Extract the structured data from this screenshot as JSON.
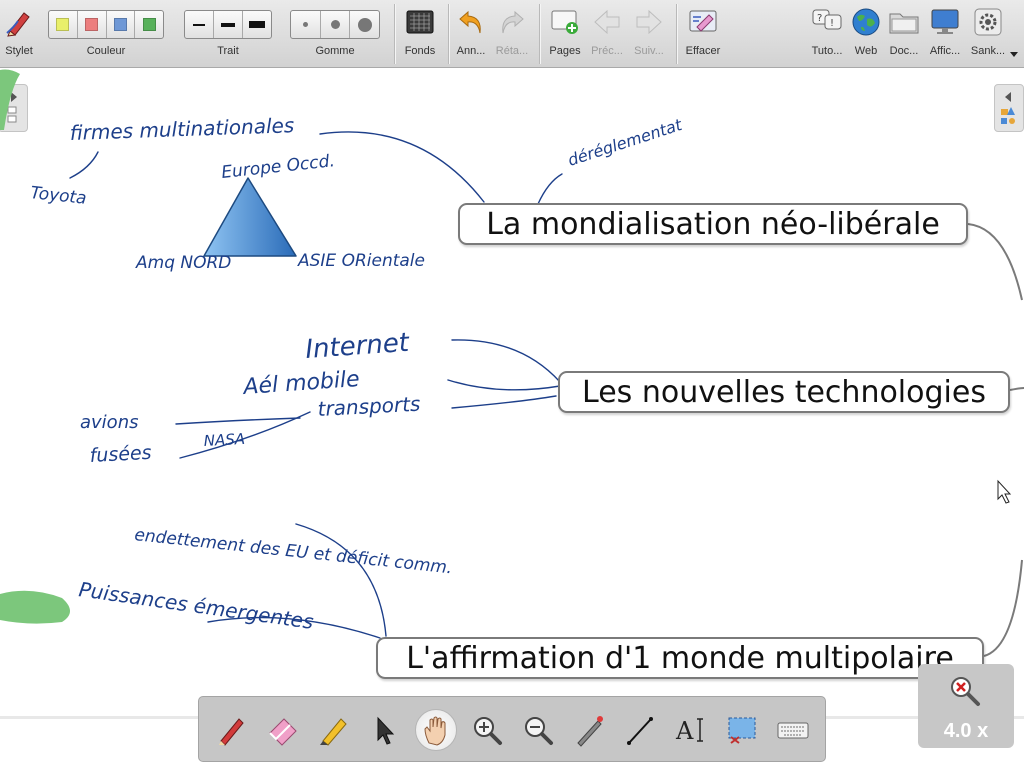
{
  "toolbar": {
    "items": [
      {
        "label": "Stylet"
      },
      {
        "label": "Couleur"
      },
      {
        "label": "Trait"
      },
      {
        "label": "Gomme"
      },
      {
        "label": "Fonds"
      },
      {
        "label": "Ann..."
      },
      {
        "label": "Réta..."
      },
      {
        "label": "Pages"
      },
      {
        "label": "Préc..."
      },
      {
        "label": "Suiv..."
      },
      {
        "label": "Effacer"
      },
      {
        "label": "Tuto..."
      },
      {
        "label": "Web"
      },
      {
        "label": "Doc..."
      },
      {
        "label": "Affic..."
      },
      {
        "label": "Sank..."
      }
    ],
    "swatch_colors": [
      "#e9ef6a",
      "#ec7e7e",
      "#6f98d6",
      "#58b15b"
    ]
  },
  "mindmap": {
    "nodes": [
      {
        "text": "La mondialisation néo-libérale"
      },
      {
        "text": "Les nouvelles technologies"
      },
      {
        "text": "L'affirmation d'1 monde multipolaire"
      }
    ],
    "annotations": [
      "firmes multinationales",
      "Toyota",
      "Europe Occd.",
      "Amq NORD",
      "ASIE ORientale",
      "déréglementat",
      "Internet",
      "Aél mobile",
      "transports",
      "avions",
      "fusées",
      "NASA",
      "endettement des EU et déficit comm.",
      "Puissances émergentes"
    ]
  },
  "zoom": {
    "value": "4.0 x"
  },
  "colors": {
    "ink": "#1d3f8a",
    "triangle": "#4a90d8",
    "highlighter": "#7cc77c"
  }
}
